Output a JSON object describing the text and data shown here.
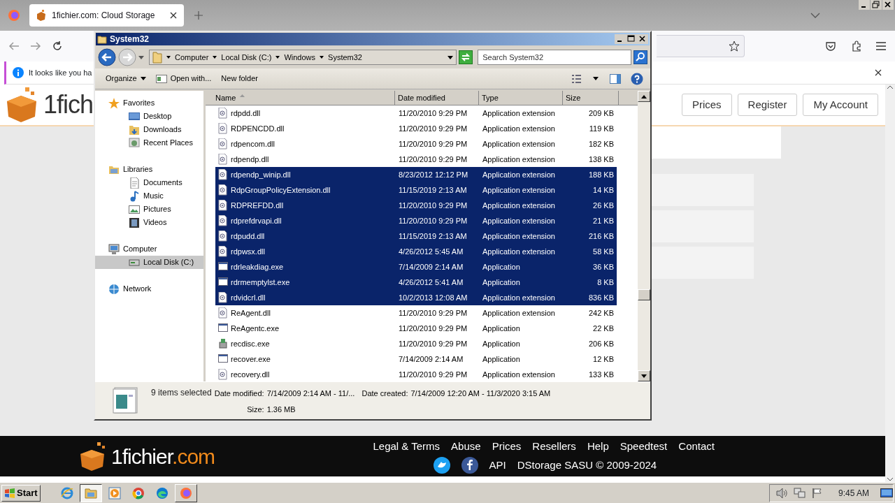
{
  "browser": {
    "tabs": [
      {
        "label": "1fichier.com: Cloud Storage",
        "selected": true
      }
    ],
    "notification": "It looks like you ha"
  },
  "page": {
    "logo": "1fich",
    "header_buttons": [
      "Prices",
      "Register",
      "My Account"
    ],
    "footer": {
      "logo_main": "1fichier",
      "logo_suffix": ".com",
      "links": [
        "Legal & Terms",
        "Abuse",
        "Prices",
        "Resellers",
        "Help",
        "Speedtest",
        "Contact"
      ],
      "social": [
        {
          "kind": "twitter"
        },
        {
          "kind": "facebook"
        }
      ],
      "bottom_links": [
        "API"
      ],
      "copyright": "DStorage SASU © 2009-2024"
    }
  },
  "explorer": {
    "title": "System32",
    "breadcrumb": [
      "Computer",
      "Local Disk (C:)",
      "Windows",
      "System32"
    ],
    "search": {
      "placeholder": "Search System32"
    },
    "toolbar": [
      {
        "label": "Organize",
        "kind": "menu"
      },
      {
        "label": "Open with...",
        "kind": "open"
      },
      {
        "label": "New folder",
        "kind": "plain"
      }
    ],
    "nav_tree": [
      {
        "label": "Favorites",
        "kind": "star",
        "selected": false,
        "children": [
          {
            "label": "Desktop",
            "kind": "desktop",
            "selected": false
          },
          {
            "label": "Downloads",
            "kind": "downloads",
            "selected": false
          },
          {
            "label": "Recent Places",
            "kind": "recent",
            "selected": false
          }
        ]
      },
      {
        "label": "Libraries",
        "kind": "library",
        "selected": false,
        "children": [
          {
            "label": "Documents",
            "kind": "documents",
            "selected": false
          },
          {
            "label": "Music",
            "kind": "music",
            "selected": false
          },
          {
            "label": "Pictures",
            "kind": "pictures",
            "selected": false
          },
          {
            "label": "Videos",
            "kind": "videos",
            "selected": false
          }
        ]
      },
      {
        "label": "Computer",
        "kind": "computer",
        "selected": false,
        "children": [
          {
            "label": "Local Disk (C:)",
            "kind": "disk",
            "selected": true
          }
        ]
      },
      {
        "label": "Network",
        "kind": "network",
        "selected": false
      }
    ],
    "columns": [
      {
        "label": "Name",
        "sorted": true
      },
      {
        "label": "Date modified",
        "sorted": false
      },
      {
        "label": "Type",
        "sorted": false
      },
      {
        "label": "Size",
        "sorted": false
      }
    ],
    "files": [
      {
        "name": "rdpdd.dll",
        "date": "11/20/2010 9:29 PM",
        "type": "Application extension",
        "size": "209 KB",
        "kind": "library",
        "selected": false
      },
      {
        "name": "RDPENCDD.dll",
        "date": "11/20/2010 9:29 PM",
        "type": "Application extension",
        "size": "119 KB",
        "kind": "library",
        "selected": false
      },
      {
        "name": "rdpencom.dll",
        "date": "11/20/2010 9:29 PM",
        "type": "Application extension",
        "size": "182 KB",
        "kind": "library",
        "selected": false
      },
      {
        "name": "rdpendp.dll",
        "date": "11/20/2010 9:29 PM",
        "type": "Application extension",
        "size": "138 KB",
        "kind": "library",
        "selected": false
      },
      {
        "name": "rdpendp_winip.dll",
        "date": "8/23/2012 12:12 PM",
        "type": "Application extension",
        "size": "188 KB",
        "kind": "library",
        "selected": true
      },
      {
        "name": "RdpGroupPolicyExtension.dll",
        "date": "11/15/2019 2:13 AM",
        "type": "Application extension",
        "size": "14 KB",
        "kind": "library",
        "selected": true
      },
      {
        "name": "RDPREFDD.dll",
        "date": "11/20/2010 9:29 PM",
        "type": "Application extension",
        "size": "26 KB",
        "kind": "library",
        "selected": true
      },
      {
        "name": "rdprefdrvapi.dll",
        "date": "11/20/2010 9:29 PM",
        "type": "Application extension",
        "size": "21 KB",
        "kind": "library",
        "selected": true
      },
      {
        "name": "rdpudd.dll",
        "date": "11/15/2019 2:13 AM",
        "type": "Application extension",
        "size": "216 KB",
        "kind": "library",
        "selected": true
      },
      {
        "name": "rdpwsx.dll",
        "date": "4/26/2012 5:45 AM",
        "type": "Application extension",
        "size": "58 KB",
        "kind": "library",
        "selected": true
      },
      {
        "name": "rdrleakdiag.exe",
        "date": "7/14/2009 2:14 AM",
        "type": "Application",
        "size": "36 KB",
        "kind": "program",
        "selected": true
      },
      {
        "name": "rdrmemptylst.exe",
        "date": "4/26/2012 5:41 AM",
        "type": "Application",
        "size": "8 KB",
        "kind": "program",
        "selected": true
      },
      {
        "name": "rdvidcrl.dll",
        "date": "10/2/2013 12:08 AM",
        "type": "Application extension",
        "size": "836 KB",
        "kind": "library",
        "selected": true
      },
      {
        "name": "ReAgent.dll",
        "date": "11/20/2010 9:29 PM",
        "type": "Application extension",
        "size": "242 KB",
        "kind": "library",
        "selected": false
      },
      {
        "name": "ReAgentc.exe",
        "date": "11/20/2010 9:29 PM",
        "type": "Application",
        "size": "22 KB",
        "kind": "program",
        "selected": false
      },
      {
        "name": "recdisc.exe",
        "date": "11/20/2010 9:29 PM",
        "type": "Application",
        "size": "206 KB",
        "kind": "setup",
        "selected": false
      },
      {
        "name": "recover.exe",
        "date": "7/14/2009 2:14 AM",
        "type": "Application",
        "size": "12 KB",
        "kind": "program",
        "selected": false
      },
      {
        "name": "recovery.dll",
        "date": "11/20/2010 9:29 PM",
        "type": "Application extension",
        "size": "133 KB",
        "kind": "library",
        "selected": false
      }
    ],
    "details": {
      "summary": "9 items selected",
      "fields": [
        {
          "label": "Date modified:",
          "value": "7/14/2009 2:14 AM - 11/..."
        },
        {
          "label": "Date created:",
          "value": "7/14/2009 12:20 AM - 11/3/2020 3:15 AM"
        },
        {
          "label": "Size:",
          "value": "1.36 MB"
        }
      ]
    }
  },
  "taskbar": {
    "start": "Start",
    "apps": [
      {
        "kind": "ie",
        "open": false,
        "focused": false
      },
      {
        "kind": "explorer",
        "open": true,
        "focused": true
      },
      {
        "kind": "media",
        "open": false,
        "focused": false
      },
      {
        "kind": "chrome",
        "open": false,
        "focused": false
      },
      {
        "kind": "edge",
        "open": false,
        "focused": false
      },
      {
        "kind": "firefox",
        "open": true,
        "focused": false
      }
    ],
    "clock": "9:45 AM"
  }
}
